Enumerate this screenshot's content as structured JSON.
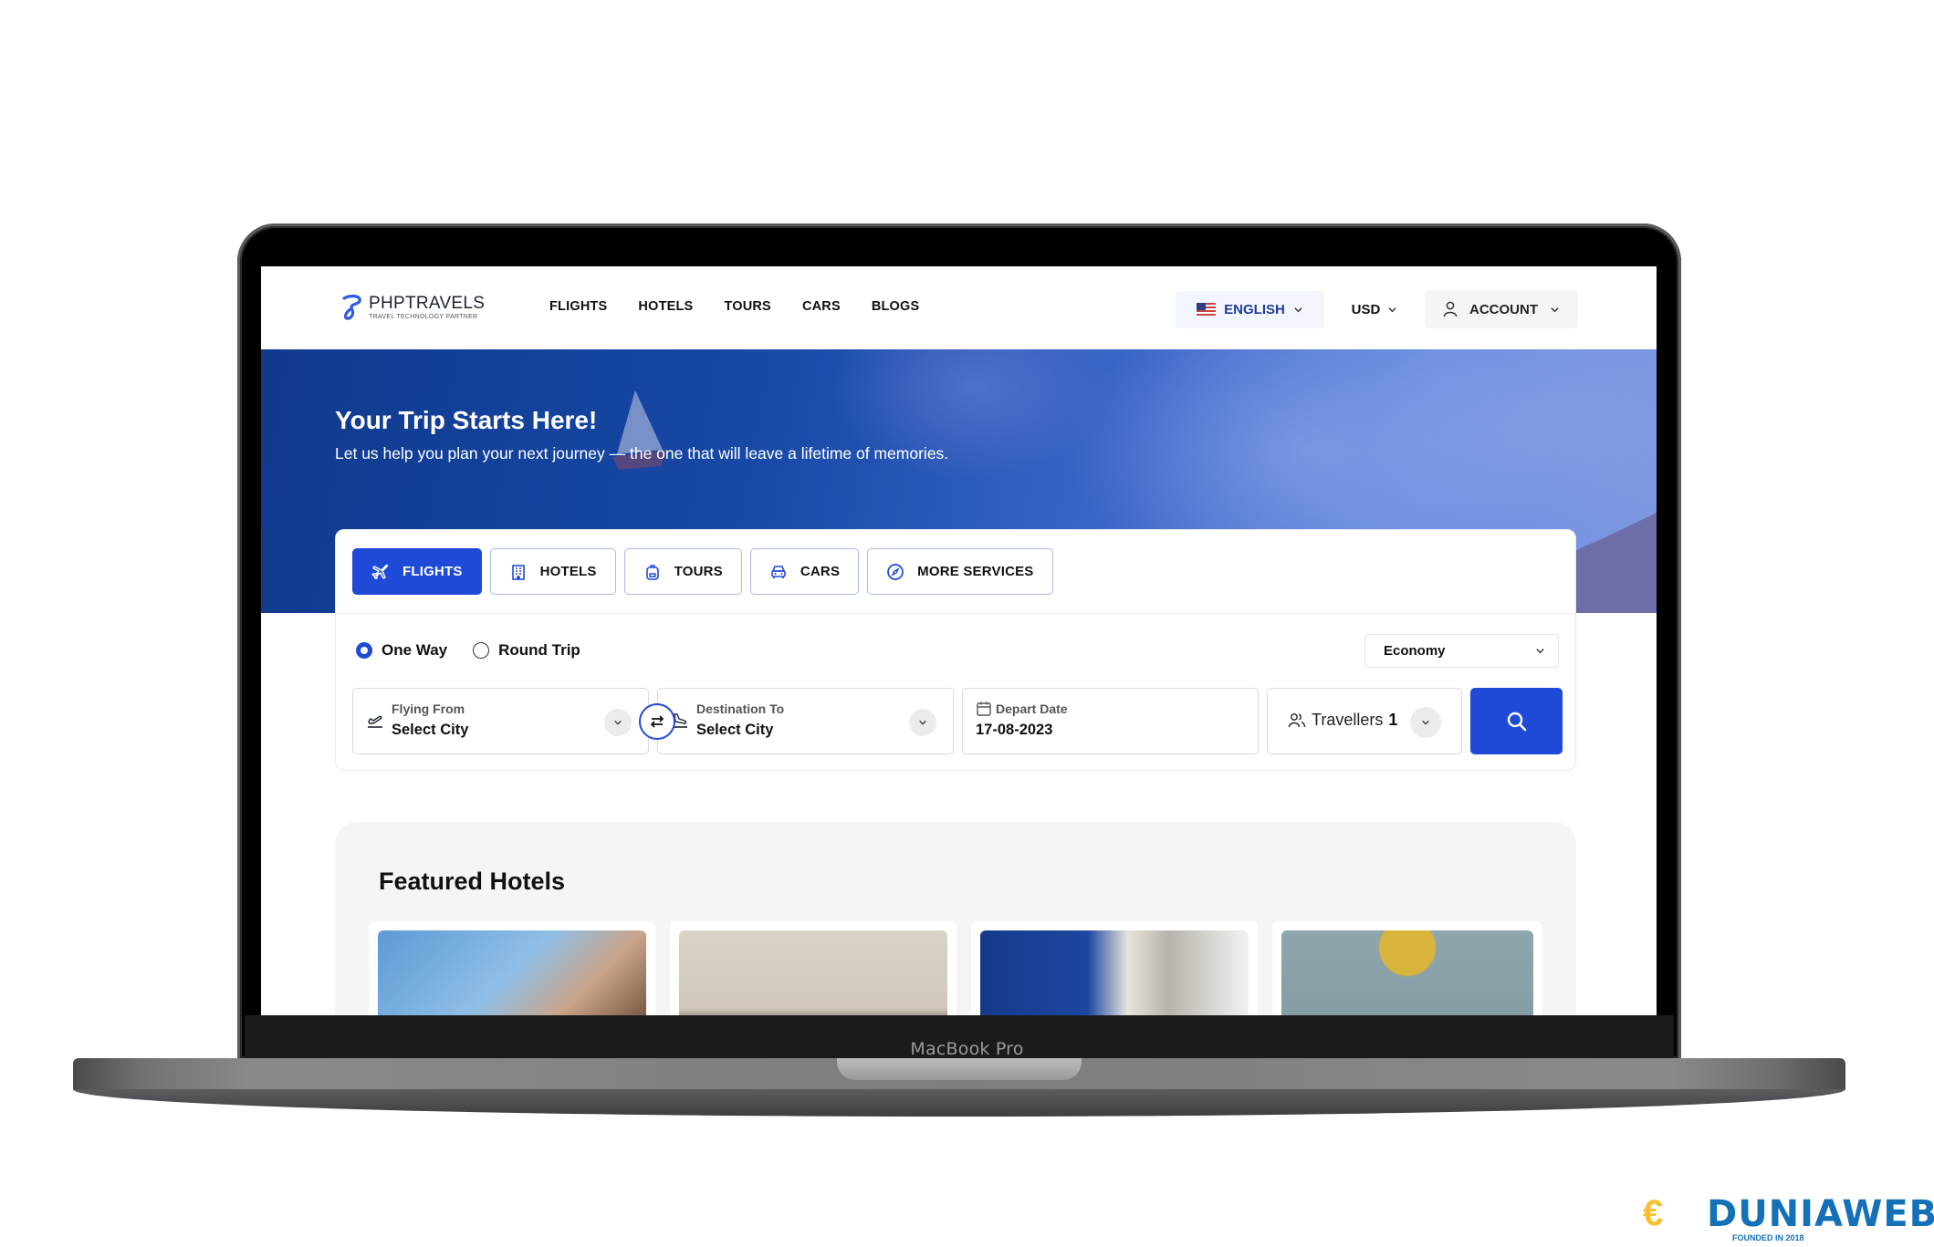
{
  "device": {
    "label": "MacBook Pro"
  },
  "nav": {
    "logo": {
      "name": "PHPTRAVELS",
      "tagline": "TRAVEL TECHNOLOGY PARTNER"
    },
    "links": [
      {
        "label": "FLIGHTS"
      },
      {
        "label": "HOTELS"
      },
      {
        "label": "TOURS"
      },
      {
        "label": "CARS"
      },
      {
        "label": "BLOGS"
      }
    ],
    "language": {
      "label": "ENGLISH",
      "flag": "us-flag-icon"
    },
    "currency": {
      "label": "USD"
    },
    "account": {
      "label": "ACCOUNT"
    }
  },
  "hero": {
    "title": "Your Trip Starts Here!",
    "subtitle": "Let us help you plan your next journey — the one that will leave a lifetime of memories."
  },
  "search": {
    "tabs": [
      {
        "label": "FLIGHTS",
        "icon": "plane-icon",
        "active": true
      },
      {
        "label": "HOTELS",
        "icon": "building-icon",
        "active": false
      },
      {
        "label": "TOURS",
        "icon": "backpack-icon",
        "active": false
      },
      {
        "label": "CARS",
        "icon": "car-icon",
        "active": false
      },
      {
        "label": "MORE SERVICES",
        "icon": "compass-icon",
        "active": false
      }
    ],
    "trip_types": [
      {
        "label": "One Way",
        "checked": true
      },
      {
        "label": "Round Trip",
        "checked": false
      }
    ],
    "cabin_class": {
      "selected": "Economy"
    },
    "from": {
      "label": "Flying From",
      "value": "Select City"
    },
    "to": {
      "label": "Destination To",
      "value": "Select City"
    },
    "depart": {
      "label": "Depart Date",
      "value": "17-08-2023"
    },
    "travellers": {
      "label": "Travellers",
      "count": "1"
    },
    "accent_color": "#1f4ad8"
  },
  "featured": {
    "title": "Featured Hotels",
    "hotels": [
      {
        "image": "hotel-exterior"
      },
      {
        "image": "hotel-lobby"
      },
      {
        "image": "hotel-room-blue"
      },
      {
        "image": "hotel-room-teal"
      }
    ]
  },
  "watermark": {
    "brand": "DUNIAWEB",
    "tagline": "FOUNDED IN 2018"
  }
}
